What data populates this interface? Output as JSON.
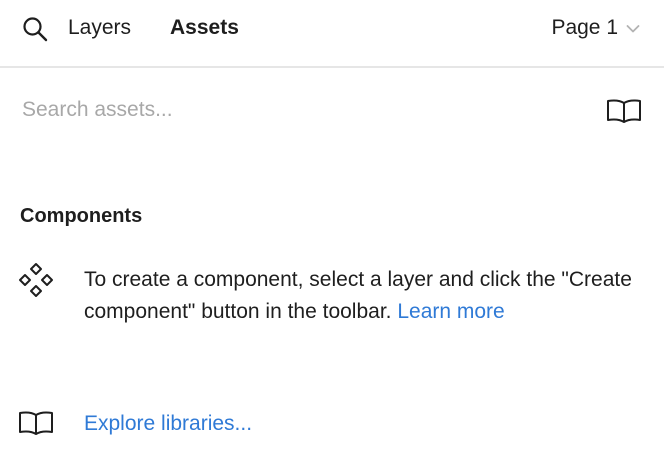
{
  "header": {
    "tabs": [
      {
        "label": "Layers",
        "active": false
      },
      {
        "label": "Assets",
        "active": true
      }
    ],
    "page_selector": {
      "label": "Page 1",
      "icon": "chevron-down-icon"
    },
    "search_icon": "search-icon"
  },
  "search": {
    "placeholder": "Search assets...",
    "value": "",
    "library_icon": "book-icon"
  },
  "components": {
    "title": "Components",
    "icon": "component-icon",
    "message": "To create a component, select a layer and click the \"Create component\" button in the toolbar. ",
    "learn_more_label": "Learn more"
  },
  "libraries": {
    "icon": "book-icon",
    "explore_label": "Explore libraries..."
  },
  "colors": {
    "text": "#1e1e1e",
    "link": "#2f7ad6",
    "placeholder": "#a8a8a8",
    "divider": "#e6e6e6"
  }
}
